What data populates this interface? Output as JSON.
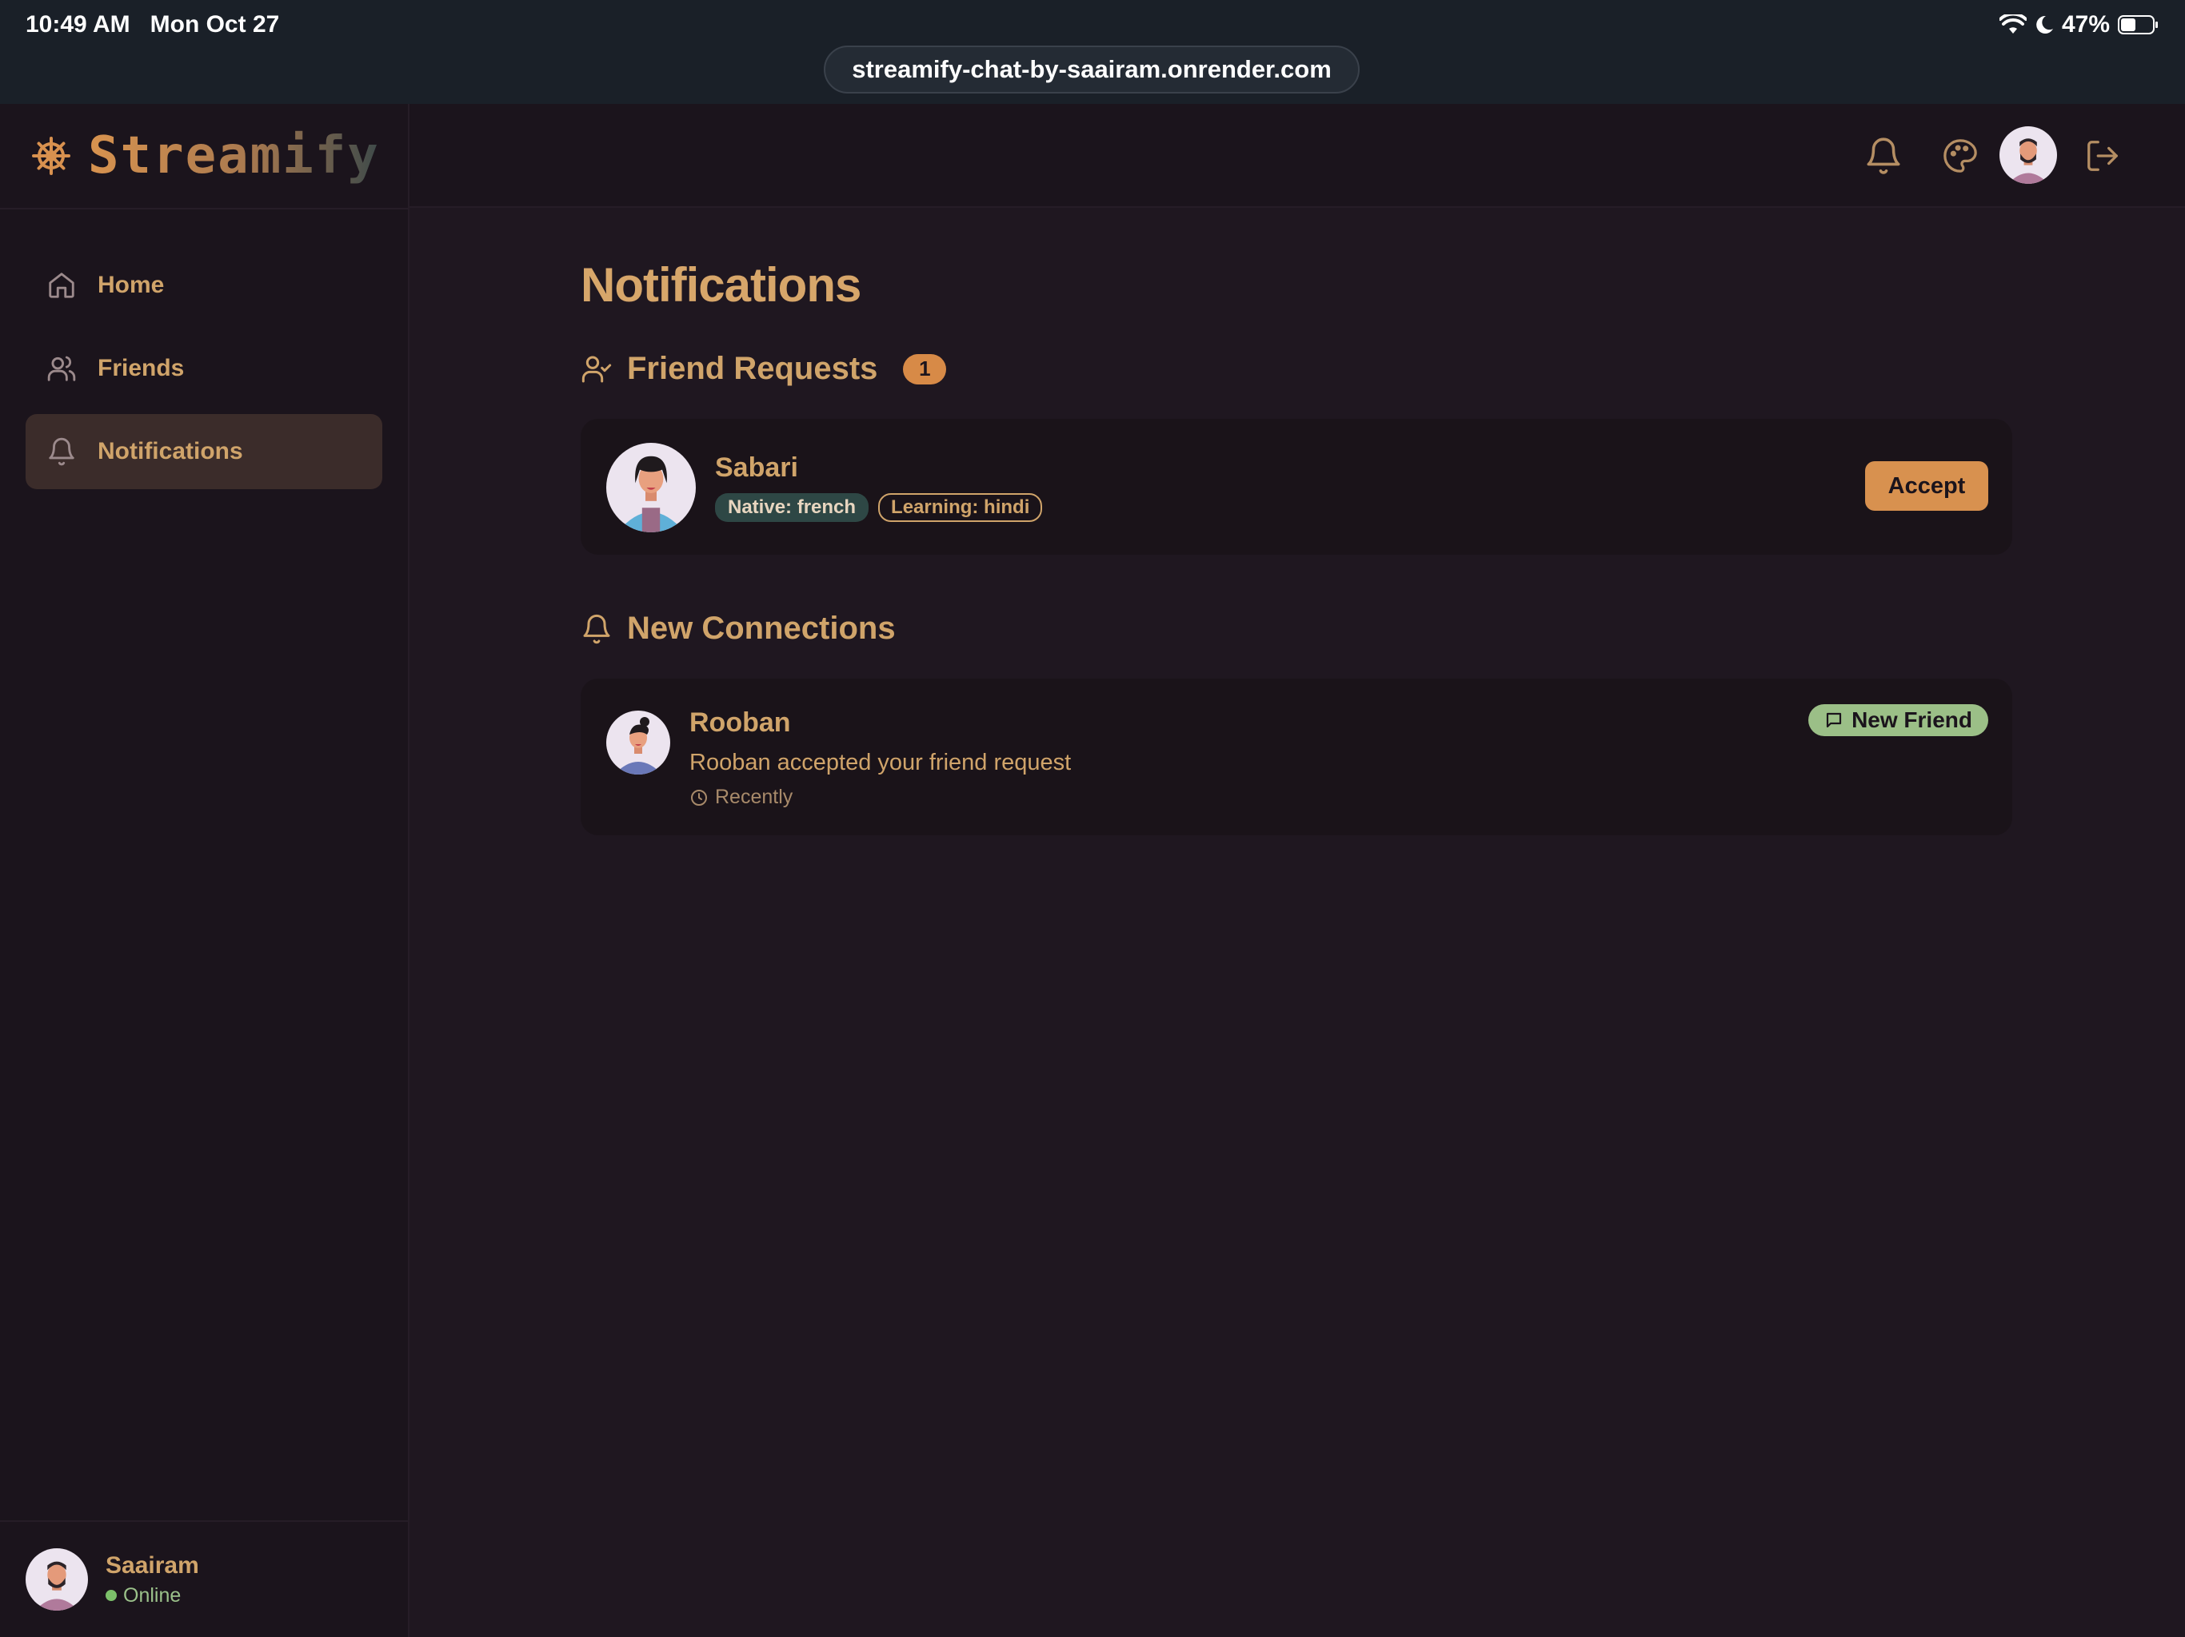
{
  "status_bar": {
    "time": "10:49 AM",
    "date": "Mon Oct 27",
    "battery": "47%"
  },
  "browser": {
    "url": "streamify-chat-by-saairam.onrender.com"
  },
  "brand": {
    "name": "Streamify",
    "icon": "ship-wheel-icon"
  },
  "sidebar": {
    "items": [
      {
        "label": "Home",
        "icon": "home-icon"
      },
      {
        "label": "Friends",
        "icon": "users-icon"
      },
      {
        "label": "Notifications",
        "icon": "bell-icon",
        "active": true
      }
    ],
    "user": {
      "name": "Saairam",
      "status": "Online"
    }
  },
  "header": {
    "icons": [
      "bell-icon",
      "palette-icon",
      "avatar",
      "logout-icon"
    ]
  },
  "page": {
    "title": "Notifications",
    "friend_requests": {
      "heading": "Friend Requests",
      "count": "1",
      "items": [
        {
          "name": "Sabari",
          "native": "Native: french",
          "learning": "Learning: hindi",
          "action": "Accept"
        }
      ]
    },
    "new_connections": {
      "heading": "New Connections",
      "items": [
        {
          "name": "Rooban",
          "message": "Rooban accepted your friend request",
          "time": "Recently",
          "badge": "New Friend"
        }
      ]
    }
  },
  "colors": {
    "accent": "#d8914f",
    "text": "#d0a46a",
    "background": "#1f1720",
    "online": "#7cc06a",
    "badge_green": "#9bbf87"
  }
}
